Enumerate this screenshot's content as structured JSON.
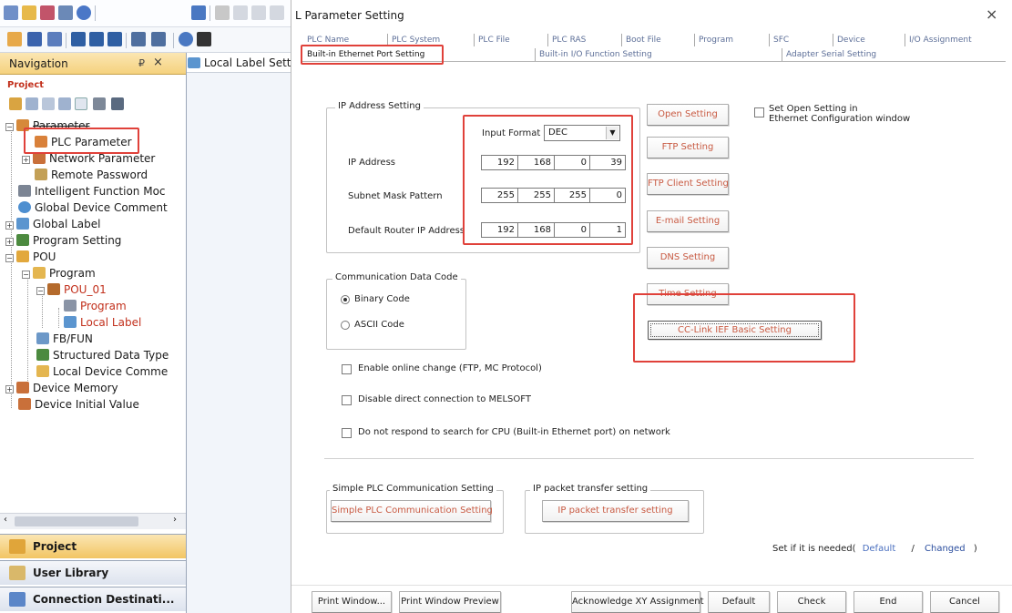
{
  "app": {
    "navigation": {
      "title": "Navigation",
      "pin_glyph": "₽",
      "close_glyph": "×",
      "section_label": "Project"
    },
    "tree": [
      {
        "id": "parameter",
        "label": "Parameter"
      },
      {
        "id": "plc-parameter",
        "label": "PLC Parameter"
      },
      {
        "id": "network-parameter",
        "label": "Network Parameter"
      },
      {
        "id": "remote-password",
        "label": "Remote Password"
      },
      {
        "id": "intelligent-function-module",
        "label": "Intelligent Function Moc"
      },
      {
        "id": "global-device-comment",
        "label": "Global Device Comment"
      },
      {
        "id": "global-label",
        "label": "Global Label"
      },
      {
        "id": "program-setting",
        "label": "Program Setting"
      },
      {
        "id": "pou",
        "label": "POU"
      },
      {
        "id": "program-folder",
        "label": "Program"
      },
      {
        "id": "pou-01",
        "label": "POU_01"
      },
      {
        "id": "program",
        "label": "Program"
      },
      {
        "id": "local-label",
        "label": "Local Label"
      },
      {
        "id": "fb-fun",
        "label": "FB/FUN"
      },
      {
        "id": "structured-data-type",
        "label": "Structured Data Type"
      },
      {
        "id": "local-device-comment",
        "label": "Local Device Comme"
      },
      {
        "id": "device-memory",
        "label": "Device Memory"
      },
      {
        "id": "device-initial-value",
        "label": "Device Initial Value"
      }
    ],
    "bottom_tabs": [
      {
        "label": "Project"
      },
      {
        "label": "User Library"
      },
      {
        "label": "Connection Destinati..."
      }
    ],
    "editor_tab": "Local Label Setting"
  },
  "dialog": {
    "title": "L Parameter Setting",
    "close_glyph": "×",
    "tabs_row1": [
      "PLC Name",
      "PLC System",
      "PLC File",
      "PLC RAS",
      "Boot File",
      "Program",
      "SFC",
      "Device",
      "I/O Assignment"
    ],
    "tabs_row2": [
      "Built-in Ethernet Port Setting",
      "Built-in I/O Function Setting",
      "Adapter Serial Setting"
    ],
    "ip_group": {
      "title": "IP Address Setting",
      "input_format_label": "Input Format",
      "input_format_value": "DEC",
      "ip_address_label": "IP Address",
      "ip_address": [
        "192",
        "168",
        "0",
        "39"
      ],
      "subnet_label": "Subnet Mask Pattern",
      "subnet": [
        "255",
        "255",
        "255",
        "0"
      ],
      "router_label": "Default Router IP Address",
      "router": [
        "192",
        "168",
        "0",
        "1"
      ]
    },
    "right_buttons": {
      "open_setting": "Open Setting",
      "ftp_setting": "FTP Setting",
      "ftp_client_setting": "FTP Client Setting",
      "email_setting": "E-mail Setting",
      "dns_setting": "DNS Setting",
      "time_setting": "Time Setting",
      "cclink_setting": "CC-Link IEF Basic Setting"
    },
    "open_in_window_label": "Set Open Setting in\nEthernet Configuration window",
    "comm_group": {
      "title": "Communication Data Code",
      "binary": "Binary Code",
      "ascii": "ASCII Code",
      "selected": "Binary Code"
    },
    "checkboxes": {
      "online_change": "Enable online change (FTP, MC Protocol)",
      "disable_direct": "Disable direct connection to MELSOFT",
      "no_respond": "Do not respond to search for CPU (Built-in Ethernet port) on network"
    },
    "simple_plc": {
      "title": "Simple PLC Communication Setting",
      "button": "Simple PLC Communication Setting"
    },
    "ip_packet": {
      "title": "IP packet transfer setting",
      "button": "IP packet transfer setting"
    },
    "status": {
      "prefix": "Set if it is needed(",
      "default": "Default",
      "slash": "/",
      "changed": "Changed",
      "suffix": ")"
    },
    "footer_buttons": {
      "print_window": "Print Window...",
      "print_preview": "Print Window Preview",
      "acknowledge_xy": "Acknowledge XY Assignment",
      "default": "Default",
      "check": "Check",
      "end": "End",
      "cancel": "Cancel"
    }
  },
  "colors": {
    "highlight_box": "#e0413a",
    "tab_text": "#5d6f98",
    "button_text": "#c85a42",
    "nav_header": "#f5d27e"
  }
}
